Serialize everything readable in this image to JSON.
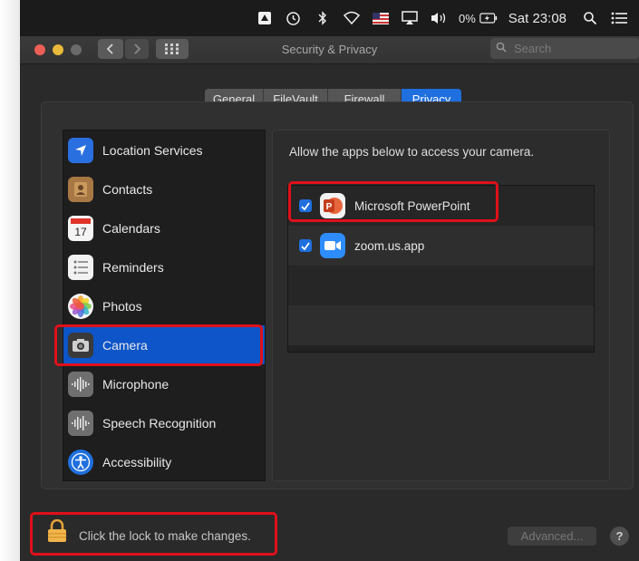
{
  "menubar": {
    "icons": [
      "drive-icon",
      "time-machine-icon",
      "bluetooth-icon",
      "wifi-icon",
      "flag-icon",
      "airplay-icon",
      "volume-icon",
      "battery-icon",
      "search-icon",
      "list-icon"
    ],
    "battery_label": "0%",
    "time": "Sat 23:08"
  },
  "window": {
    "title": "Security & Privacy",
    "search_placeholder": "Search"
  },
  "tabs": [
    {
      "label": "General"
    },
    {
      "label": "FileVault"
    },
    {
      "label": "Firewall"
    },
    {
      "label": "Privacy",
      "active": true
    }
  ],
  "sidebar": {
    "items": [
      {
        "label": "Location Services",
        "icon": "location-arrow-icon"
      },
      {
        "label": "Contacts",
        "icon": "contacts-book-icon"
      },
      {
        "label": "Calendars",
        "icon": "calendar-icon",
        "day": "17"
      },
      {
        "label": "Reminders",
        "icon": "reminders-list-icon"
      },
      {
        "label": "Photos",
        "icon": "photos-flower-icon"
      },
      {
        "label": "Camera",
        "icon": "camera-icon",
        "selected": true
      },
      {
        "label": "Microphone",
        "icon": "microphone-waveform-icon"
      },
      {
        "label": "Speech Recognition",
        "icon": "speech-waveform-icon"
      },
      {
        "label": "Accessibility",
        "icon": "accessibility-figure-icon"
      }
    ]
  },
  "pane": {
    "description": "Allow the apps below to access your camera.",
    "apps": [
      {
        "label": "Microsoft PowerPoint",
        "checked": true,
        "icon": "powerpoint-icon",
        "icon_letter": "P"
      },
      {
        "label": "zoom.us.app",
        "checked": true,
        "icon": "zoom-camera-icon"
      }
    ]
  },
  "footer": {
    "lock_text": "Click the lock to make changes.",
    "advanced_label": "Advanced...",
    "help_label": "?"
  },
  "colors": {
    "accent": "#1f6fde",
    "selection": "#0d55c9",
    "highlight_box": "#e0101a"
  }
}
